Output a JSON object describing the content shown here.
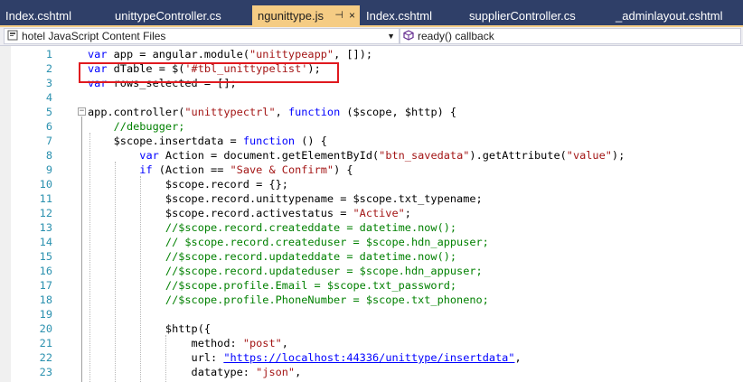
{
  "tabs": [
    {
      "label": "Index.cshtml",
      "active": false
    },
    {
      "label": "unittypeController.cs",
      "active": false
    },
    {
      "label": "ngunittype.js",
      "active": true,
      "pin": "⊣",
      "close": "×"
    },
    {
      "label": "Index.cshtml",
      "active": false
    },
    {
      "label": "supplierController.cs",
      "active": false
    },
    {
      "label": "_adminlayout.cshtml",
      "active": false
    }
  ],
  "navbar": {
    "project": "hotel JavaScript Content Files",
    "scope": "ready() callback"
  },
  "lines": [
    {
      "n": "1",
      "t": [
        {
          "c": "kw",
          "s": "var"
        },
        {
          "c": "",
          "s": " app = angular.module("
        },
        {
          "c": "str",
          "s": "\"unittypeapp\""
        },
        {
          "c": "",
          "s": ", []);"
        }
      ]
    },
    {
      "n": "2",
      "t": [
        {
          "c": "kw",
          "s": "var"
        },
        {
          "c": "",
          "s": " dTable = $("
        },
        {
          "c": "str",
          "s": "'#tbl_unittypelist'"
        },
        {
          "c": "",
          "s": ");"
        }
      ]
    },
    {
      "n": "3",
      "t": [
        {
          "c": "kw",
          "s": "var"
        },
        {
          "c": "",
          "s": " rows_selected = [];"
        }
      ]
    },
    {
      "n": "4",
      "t": []
    },
    {
      "n": "5",
      "t": [
        {
          "c": "",
          "s": "app.controller("
        },
        {
          "c": "str",
          "s": "\"unittypectrl\""
        },
        {
          "c": "",
          "s": ", "
        },
        {
          "c": "kw",
          "s": "function"
        },
        {
          "c": "",
          "s": " ($scope, $http) {"
        }
      ]
    },
    {
      "n": "6",
      "t": [
        {
          "c": "cm",
          "s": "    //debugger;"
        }
      ]
    },
    {
      "n": "7",
      "t": [
        {
          "c": "",
          "s": "    $scope.insertdata = "
        },
        {
          "c": "kw",
          "s": "function"
        },
        {
          "c": "",
          "s": " () {"
        }
      ]
    },
    {
      "n": "8",
      "t": [
        {
          "c": "",
          "s": "        "
        },
        {
          "c": "kw",
          "s": "var"
        },
        {
          "c": "",
          "s": " Action = document.getElementById("
        },
        {
          "c": "str",
          "s": "\"btn_savedata\""
        },
        {
          "c": "",
          "s": ").getAttribute("
        },
        {
          "c": "str",
          "s": "\"value\""
        },
        {
          "c": "",
          "s": ");"
        }
      ]
    },
    {
      "n": "9",
      "t": [
        {
          "c": "",
          "s": "        "
        },
        {
          "c": "kw",
          "s": "if"
        },
        {
          "c": "",
          "s": " (Action == "
        },
        {
          "c": "str",
          "s": "\"Save & Confirm\""
        },
        {
          "c": "",
          "s": ") {"
        }
      ]
    },
    {
      "n": "10",
      "t": [
        {
          "c": "",
          "s": "            $scope.record = {};"
        }
      ]
    },
    {
      "n": "11",
      "t": [
        {
          "c": "",
          "s": "            $scope.record.unittypename = $scope.txt_typename;"
        }
      ]
    },
    {
      "n": "12",
      "t": [
        {
          "c": "",
          "s": "            $scope.record.activestatus = "
        },
        {
          "c": "str",
          "s": "\"Active\""
        },
        {
          "c": "",
          "s": ";"
        }
      ]
    },
    {
      "n": "13",
      "t": [
        {
          "c": "cm",
          "s": "            //$scope.record.createddate = datetime.now();"
        }
      ]
    },
    {
      "n": "14",
      "t": [
        {
          "c": "cm",
          "s": "            // $scope.record.createduser = $scope.hdn_appuser;"
        }
      ]
    },
    {
      "n": "15",
      "t": [
        {
          "c": "cm",
          "s": "            //$scope.record.updateddate = datetime.now();"
        }
      ]
    },
    {
      "n": "16",
      "t": [
        {
          "c": "cm",
          "s": "            //$scope.record.updateduser = $scope.hdn_appuser;"
        }
      ]
    },
    {
      "n": "17",
      "t": [
        {
          "c": "cm",
          "s": "            //$scope.profile.Email = $scope.txt_password;"
        }
      ]
    },
    {
      "n": "18",
      "t": [
        {
          "c": "cm",
          "s": "            //$scope.profile.PhoneNumber = $scope.txt_phoneno;"
        }
      ]
    },
    {
      "n": "19",
      "t": []
    },
    {
      "n": "20",
      "t": [
        {
          "c": "",
          "s": "            $http({"
        }
      ]
    },
    {
      "n": "21",
      "t": [
        {
          "c": "",
          "s": "                method: "
        },
        {
          "c": "str",
          "s": "\"post\""
        },
        {
          "c": "",
          "s": ","
        }
      ]
    },
    {
      "n": "22",
      "t": [
        {
          "c": "",
          "s": "                url: "
        },
        {
          "c": "url",
          "s": "\"https://localhost:44336/unittype/insertdata\""
        },
        {
          "c": "",
          "s": ","
        }
      ]
    },
    {
      "n": "23",
      "t": [
        {
          "c": "",
          "s": "                datatype: "
        },
        {
          "c": "str",
          "s": "\"json\""
        },
        {
          "c": "",
          "s": ","
        }
      ]
    }
  ],
  "colors": {
    "tabbar": "#2f3f68",
    "active_tab": "#f5cc84",
    "keyword": "#0000ff",
    "string": "#a31515",
    "comment": "#008000",
    "line_number": "#2b91af",
    "highlight_box": "#e0191f"
  }
}
